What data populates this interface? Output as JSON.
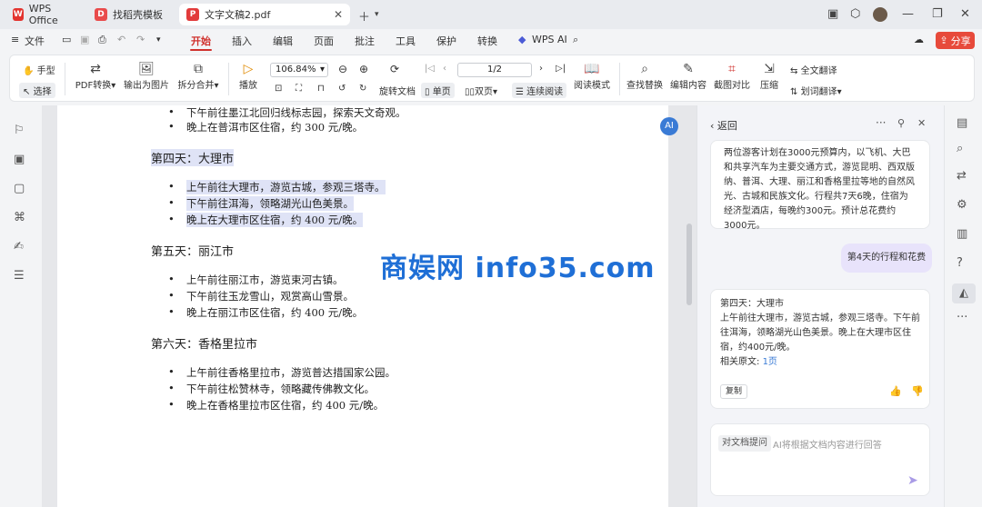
{
  "tabs": [
    {
      "label": "WPS Office",
      "icon": "wps-logo-icon"
    },
    {
      "label": "找稻壳模板",
      "icon": "docer-icon"
    },
    {
      "label": "文字文稿2.pdf",
      "icon": "pdf-icon"
    }
  ],
  "menu": {
    "file": "文件",
    "items": [
      "开始",
      "插入",
      "编辑",
      "页面",
      "批注",
      "工具",
      "保护",
      "转换",
      "WPS AI"
    ],
    "active": "开始",
    "share": "分享"
  },
  "ribbon": {
    "hand": "手型",
    "select": "选择",
    "pdf_convert": "PDF转换",
    "export_image": "输出为图片",
    "split_merge": "拆分合并",
    "play": "播放",
    "zoom": "106.84%",
    "rotate": "旋转文档",
    "single": "单页",
    "double": "双页",
    "continuous": "连续阅读",
    "page": "1/2",
    "read_mode": "阅读模式",
    "find_replace": "查找替换",
    "edit_content": "编辑内容",
    "screenshot_compare": "截图对比",
    "compress": "压缩",
    "full_translate": "全文翻译",
    "word_translate": "划词翻译"
  },
  "document": {
    "top_bullets": [
      "下午前往墨江北回归线标志园，探索天文奇观。",
      "晚上在普洱市区住宿，约 300 元/晚。"
    ],
    "sections": [
      {
        "title": "第四天：大理市",
        "bullets": [
          "上午前往大理市，游览古城，参观三塔寺。",
          "下午前往洱海，领略湖光山色美景。",
          "晚上在大理市区住宿，约 400 元/晚。"
        ]
      },
      {
        "title": "第五天：丽江市",
        "bullets": [
          "上午前往丽江市，游览束河古镇。",
          "下午前往玉龙雪山，观赏高山雪景。",
          "晚上在丽江市区住宿，约 400 元/晚。"
        ]
      },
      {
        "title": "第六天：香格里拉市",
        "bullets": [
          "上午前往香格里拉市，游览普达措国家公园。",
          "下午前往松赞林寺，领略藏传佛教文化。",
          "晚上在香格里拉市区住宿，约 400 元/晚。"
        ]
      }
    ]
  },
  "panel": {
    "back": "返回",
    "summary": "两位游客计划在3000元预算内，以飞机、大巴和共享汽车为主要交通方式，游览昆明、西双版纳、普洱、大理、丽江和香格里拉等地的自然风光、古城和民族文化。行程共7天6晚，住宿为经济型酒店，每晚约300元。预计总花费约3000元。",
    "user_query": "第4天的行程和花费",
    "answer_title": "第四天：大理市",
    "answer_body": "上午前往大理市，游览古城，参观三塔寺。下午前往洱海，领略湖光山色美景。晚上在大理市区住宿，约400元/晚。",
    "ref_label": "相关原文:",
    "ref_link": "1页",
    "copy": "复制",
    "chip": "对文档提问",
    "placeholder": "AI将根据文档内容进行回答"
  },
  "watermark": "商娱网 info35.com",
  "colors": {
    "accent": "#d0312d",
    "share": "#e74a3b",
    "selection": "#dfe3f6",
    "bubble": "#e8e3fb",
    "link": "#3a7bd5"
  }
}
